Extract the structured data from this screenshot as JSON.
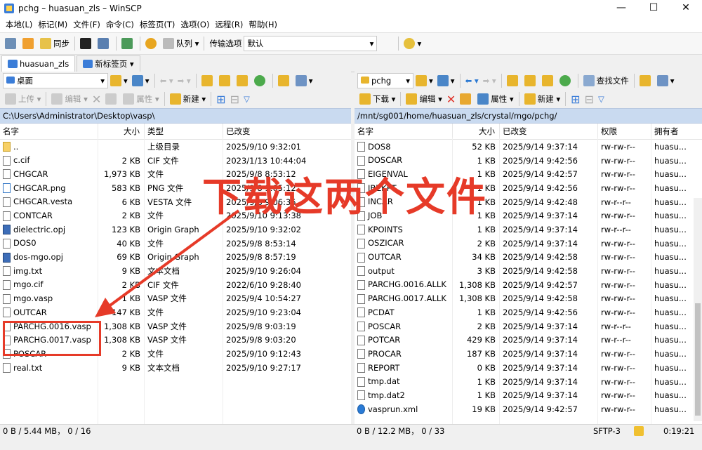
{
  "window": {
    "title": "pchg – huasuan_zls – WinSCP"
  },
  "menu": [
    "本地(L)",
    "标记(M)",
    "文件(F)",
    "命令(C)",
    "标签页(T)",
    "选项(O)",
    "远程(R)",
    "帮助(H)"
  ],
  "toolbar": {
    "sync_label": "同步",
    "queue_label": "队列",
    "transfer_label": "传输选项",
    "transfer_value": "默认"
  },
  "tabs": [
    {
      "label": "huasuan_zls"
    },
    {
      "label": "新标签页"
    }
  ],
  "left": {
    "location": "桌面",
    "actions": {
      "upload": "上传",
      "edit": "编辑",
      "props": "属性",
      "new": "新建"
    },
    "path": "C:\\Users\\Administrator\\Desktop\\vasp\\",
    "columns": [
      "名字",
      "大小",
      "类型",
      "已改变"
    ],
    "rows": [
      [
        "..",
        "",
        "上级目录",
        "2025/9/10 9:32:01"
      ],
      [
        "c.cif",
        "2 KB",
        "CIF 文件",
        "2023/1/13 10:44:04"
      ],
      [
        "CHGCAR",
        "1,973 KB",
        "文件",
        "2025/9/8 8:53:12"
      ],
      [
        "CHGCAR.png",
        "583 KB",
        "PNG 文件",
        "2025/9/8 9:05:12"
      ],
      [
        "CHGCAR.vesta",
        "6 KB",
        "VESTA 文件",
        "2025/9/8 9:06:35"
      ],
      [
        "CONTCAR",
        "2 KB",
        "文件",
        "2025/9/10 9:13:38"
      ],
      [
        "dielectric.opj",
        "123 KB",
        "Origin Graph",
        "2025/9/10 9:32:02"
      ],
      [
        "DOS0",
        "40 KB",
        "文件",
        "2025/9/8 8:53:14"
      ],
      [
        "dos-mgo.opj",
        "69 KB",
        "Origin Graph",
        "2025/9/8 8:57:19"
      ],
      [
        "img.txt",
        "9 KB",
        "文本文档",
        "2025/9/10 9:26:04"
      ],
      [
        "mgo.cif",
        "2 KB",
        "CIF 文件",
        "2022/6/10 9:28:40"
      ],
      [
        "mgo.vasp",
        "1 KB",
        "VASP 文件",
        "2025/9/4 10:54:27"
      ],
      [
        "OUTCAR",
        "147 KB",
        "文件",
        "2025/9/10 9:23:04"
      ],
      [
        "PARCHG.0016.vasp",
        "1,308 KB",
        "VASP 文件",
        "2025/9/8 9:03:19"
      ],
      [
        "PARCHG.0017.vasp",
        "1,308 KB",
        "VASP 文件",
        "2025/9/8 9:03:20"
      ],
      [
        "POSCAR",
        "2 KB",
        "文件",
        "2025/9/10 9:12:43"
      ],
      [
        "real.txt",
        "9 KB",
        "文本文档",
        "2025/9/10 9:27:17"
      ]
    ],
    "status": "0 B / 5.44 MB，  0 / 16"
  },
  "right": {
    "location": "pchg",
    "actions": {
      "download": "下载",
      "edit": "编辑",
      "props": "属性",
      "new": "新建",
      "find": "查找文件"
    },
    "path": "/mnt/sg001/home/huasuan_zls/crystal/mgo/pchg/",
    "columns": [
      "名字",
      "大小",
      "已改变",
      "权限",
      "拥有者"
    ],
    "rows": [
      [
        "DOS8",
        "52 KB",
        "2025/9/14 9:37:14",
        "rw-rw-r--",
        "huasu..."
      ],
      [
        "DOSCAR",
        "1 KB",
        "2025/9/14 9:42:56",
        "rw-rw-r--",
        "huasu..."
      ],
      [
        "EIGENVAL",
        "1 KB",
        "2025/9/14 9:42:57",
        "rw-rw-r--",
        "huasu..."
      ],
      [
        "IBZKPT",
        "1 KB",
        "2025/9/14 9:42:56",
        "rw-rw-r--",
        "huasu..."
      ],
      [
        "INCAR",
        "1 KB",
        "2025/9/14 9:42:48",
        "rw-r--r--",
        "huasu..."
      ],
      [
        "JOB",
        "1 KB",
        "2025/9/14 9:37:14",
        "rw-rw-r--",
        "huasu..."
      ],
      [
        "KPOINTS",
        "1 KB",
        "2025/9/14 9:37:14",
        "rw-r--r--",
        "huasu..."
      ],
      [
        "OSZICAR",
        "2 KB",
        "2025/9/14 9:37:14",
        "rw-rw-r--",
        "huasu..."
      ],
      [
        "OUTCAR",
        "34 KB",
        "2025/9/14 9:42:58",
        "rw-rw-r--",
        "huasu..."
      ],
      [
        "output",
        "3 KB",
        "2025/9/14 9:42:58",
        "rw-rw-r--",
        "huasu..."
      ],
      [
        "PARCHG.0016.ALLK",
        "1,308 KB",
        "2025/9/14 9:42:57",
        "rw-rw-r--",
        "huasu..."
      ],
      [
        "PARCHG.0017.ALLK",
        "1,308 KB",
        "2025/9/14 9:42:58",
        "rw-rw-r--",
        "huasu..."
      ],
      [
        "PCDAT",
        "1 KB",
        "2025/9/14 9:42:56",
        "rw-rw-r--",
        "huasu..."
      ],
      [
        "POSCAR",
        "2 KB",
        "2025/9/14 9:37:14",
        "rw-r--r--",
        "huasu..."
      ],
      [
        "POTCAR",
        "429 KB",
        "2025/9/14 9:37:14",
        "rw-r--r--",
        "huasu..."
      ],
      [
        "PROCAR",
        "187 KB",
        "2025/9/14 9:37:14",
        "rw-rw-r--",
        "huasu..."
      ],
      [
        "REPORT",
        "0 KB",
        "2025/9/14 9:37:14",
        "rw-rw-r--",
        "huasu..."
      ],
      [
        "tmp.dat",
        "1 KB",
        "2025/9/14 9:37:14",
        "rw-rw-r--",
        "huasu..."
      ],
      [
        "tmp.dat2",
        "1 KB",
        "2025/9/14 9:37:14",
        "rw-rw-r--",
        "huasu..."
      ],
      [
        "vasprun.xml",
        "19 KB",
        "2025/9/14 9:42:57",
        "rw-rw-r--",
        "huasu..."
      ]
    ],
    "status": "0 B / 12.2 MB，  0 / 33"
  },
  "statusbar": {
    "protocol": "SFTP-3",
    "time": "0:19:21"
  },
  "annotation": {
    "text": "下载这两个文件",
    "color": "#e63a28"
  }
}
